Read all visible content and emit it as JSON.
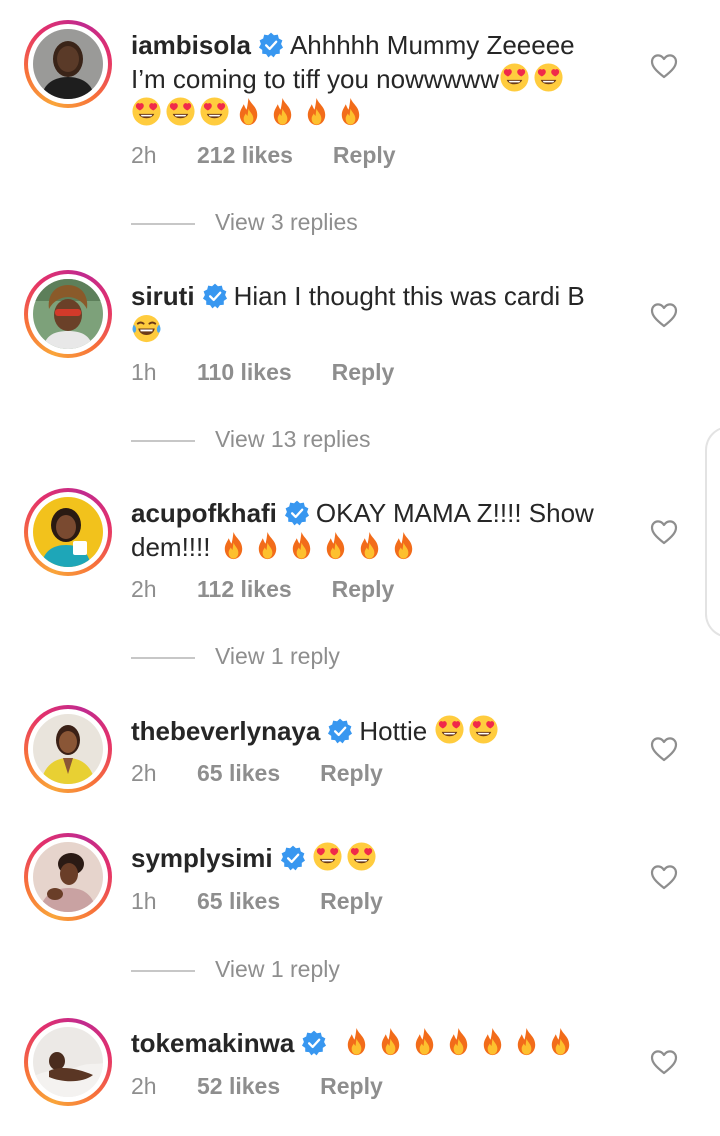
{
  "comments": [
    {
      "username": "iambisola",
      "text_line1": "Ahhhhh Mummy Zeeeee",
      "text_line2": "I’m coming to tiff you nowwwww",
      "emojis_inline": [
        "heart-eyes",
        "heart-eyes"
      ],
      "emojis_line3": [
        "heart-eyes",
        "heart-eyes",
        "heart-eyes",
        "fire",
        "fire",
        "fire",
        "fire"
      ],
      "time": "2h",
      "likes": "212 likes",
      "reply": "Reply",
      "view_replies": "View 3 replies"
    },
    {
      "username": "siruti",
      "text_line1": "Hian I thought this was cardi B",
      "emojis_line2": [
        "tears-of-joy"
      ],
      "time": "1h",
      "likes": "110 likes",
      "reply": "Reply",
      "view_replies": "View 13 replies"
    },
    {
      "username": "acupofkhafi",
      "text_line1": "OKAY MAMA Z!!!! Show",
      "text_line2": "dem!!!!",
      "emojis_line2": [
        "fire",
        "fire",
        "fire",
        "fire",
        "fire",
        "fire"
      ],
      "time": "2h",
      "likes": "112 likes",
      "reply": "Reply",
      "view_replies": "View 1 reply"
    },
    {
      "username": "thebeverlynaya",
      "text_line1": "Hottie",
      "emojis_line1": [
        "heart-eyes",
        "heart-eyes"
      ],
      "time": "2h",
      "likes": "65 likes",
      "reply": "Reply"
    },
    {
      "username": "symplysimi",
      "emojis_line1": [
        "heart-eyes",
        "heart-eyes"
      ],
      "time": "1h",
      "likes": "65 likes",
      "reply": "Reply",
      "view_replies": "View 1 reply"
    },
    {
      "username": "tokemakinwa",
      "emojis_line1": [
        "fire",
        "fire",
        "fire",
        "fire",
        "fire",
        "fire",
        "fire"
      ],
      "time": "2h",
      "likes": "52 likes",
      "reply": "Reply"
    }
  ],
  "icons": {
    "verified": "verified-badge-icon",
    "like": "heart-outline-icon"
  },
  "colors": {
    "verified_blue": "#3897f0",
    "meta_gray": "#8e8e8e",
    "text": "#262626",
    "divider": "#c7c7c7"
  }
}
